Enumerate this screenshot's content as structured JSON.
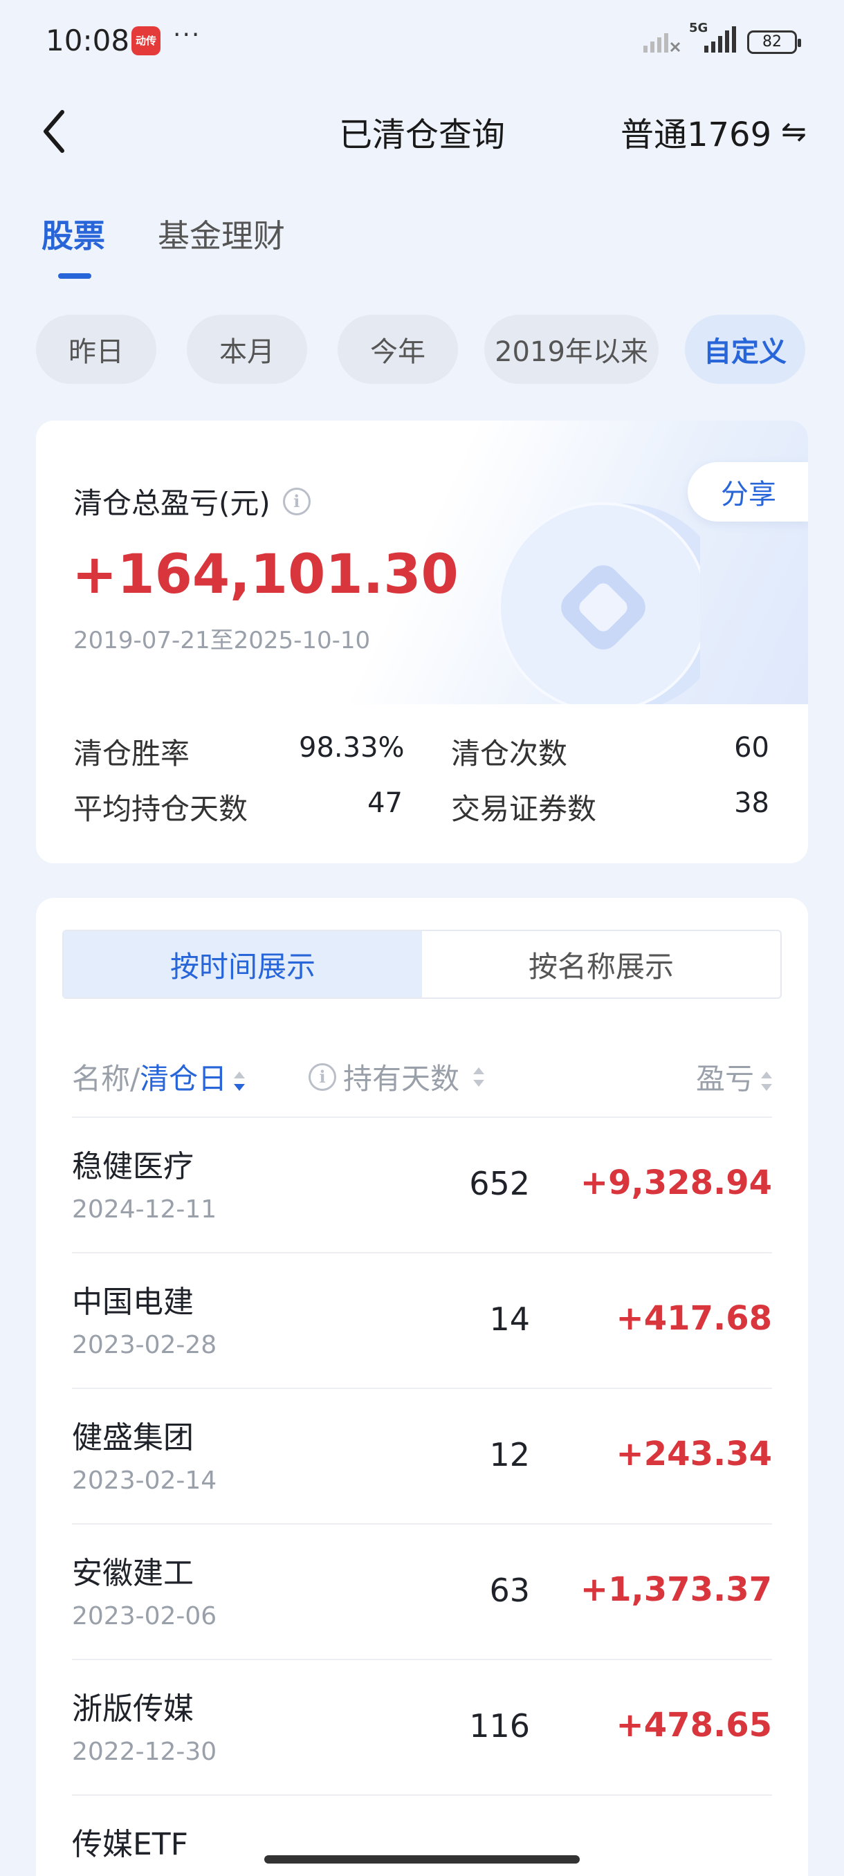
{
  "status": {
    "time": "10:08",
    "app_badge": "动传",
    "dots": "···",
    "network": "5G",
    "battery": "82"
  },
  "header": {
    "title": "已清仓查询",
    "account": "普通1769",
    "swap_icon": "⇋"
  },
  "main_tabs": [
    {
      "label": "股票",
      "active": true
    },
    {
      "label": "基金理财",
      "active": false
    }
  ],
  "period_chips": [
    {
      "label": "昨日",
      "active": false
    },
    {
      "label": "本月",
      "active": false
    },
    {
      "label": "今年",
      "active": false
    },
    {
      "label": "2019年以来",
      "active": false
    },
    {
      "label": "自定义",
      "active": true
    }
  ],
  "summary": {
    "label": "清仓总盈亏(元)",
    "info": "i",
    "share": "分享",
    "value": "+164,101.30",
    "range": "2019-07-21至2025-10-10",
    "stats": [
      {
        "label": "清仓胜率",
        "value": "98.33%"
      },
      {
        "label": "清仓次数",
        "value": "60"
      },
      {
        "label": "平均持仓天数",
        "value": "47"
      },
      {
        "label": "交易证券数",
        "value": "38"
      }
    ]
  },
  "view_toggle": {
    "by_time": "按时间展示",
    "by_name": "按名称展示",
    "active": "by_time"
  },
  "table": {
    "col_name_prefix": "名称/",
    "col_name_sort": "清仓日",
    "col_days": "持有天数",
    "col_pl": "盈亏",
    "rows": [
      {
        "name": "稳健医疗",
        "date": "2024-12-11",
        "days": "652",
        "pl": "+9,328.94"
      },
      {
        "name": "中国电建",
        "date": "2023-02-28",
        "days": "14",
        "pl": "+417.68"
      },
      {
        "name": "健盛集团",
        "date": "2023-02-14",
        "days": "12",
        "pl": "+243.34"
      },
      {
        "name": "安徽建工",
        "date": "2023-02-06",
        "days": "63",
        "pl": "+1,373.37"
      },
      {
        "name": "浙版传媒",
        "date": "2022-12-30",
        "days": "116",
        "pl": "+478.65"
      },
      {
        "name": "传媒ETF",
        "date": "",
        "days": "",
        "pl": ""
      }
    ]
  },
  "colors": {
    "accent": "#2765d8",
    "profit": "#d9353d",
    "background": "#eff3fb"
  }
}
